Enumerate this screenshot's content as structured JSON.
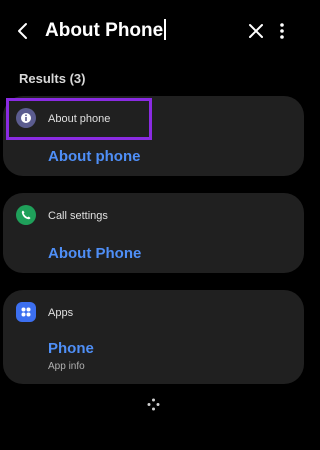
{
  "search": {
    "query": "About Phone"
  },
  "results": {
    "heading": "Results (3)",
    "items": [
      {
        "category": "About phone",
        "title": "About phone",
        "subtitle": ""
      },
      {
        "category": "Call settings",
        "title": "About Phone",
        "subtitle": ""
      },
      {
        "category": "Apps",
        "title": "Phone",
        "subtitle": "App info"
      }
    ]
  },
  "icons": {
    "back": "back-arrow-icon",
    "clear": "close-icon",
    "more": "more-vertical-icon",
    "about": "info-icon",
    "call": "phone-icon",
    "apps": "apps-grid-icon",
    "loader": "loading-dots-icon"
  },
  "colors": {
    "background": "#000000",
    "card": "#202020",
    "link": "#4f8ff7",
    "highlight": "#8a2be2",
    "about_icon": "#5b5c8f",
    "call_icon": "#1fa05a",
    "apps_icon": "#3c6ff0"
  }
}
